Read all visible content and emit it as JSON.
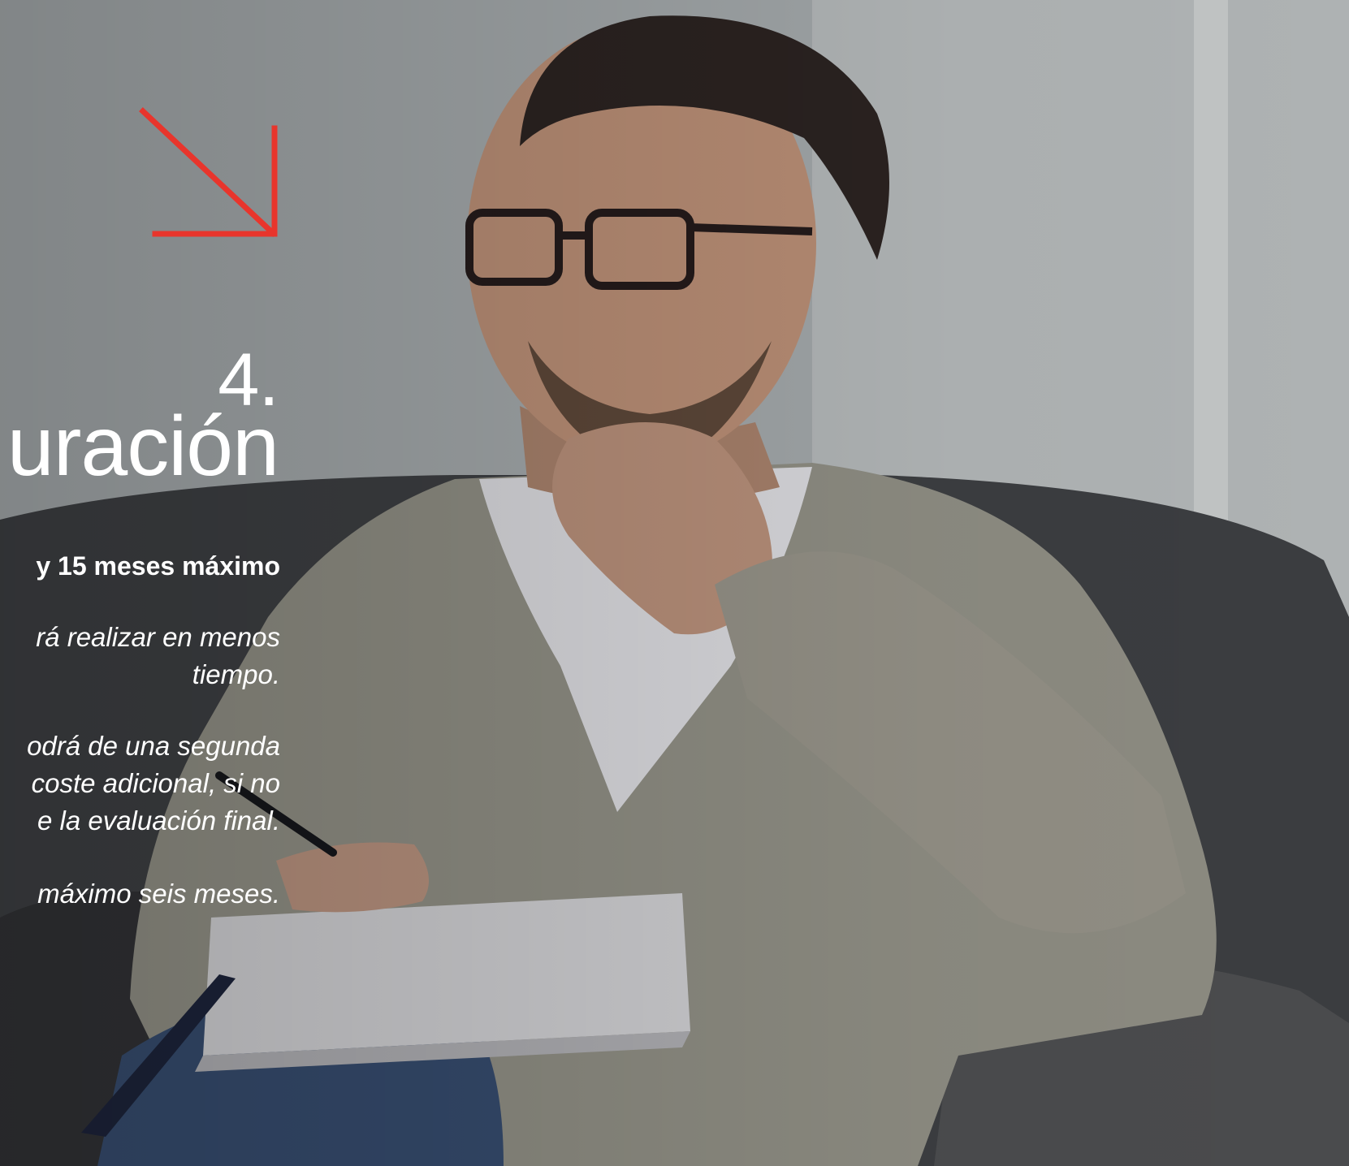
{
  "slide": {
    "number": "4.",
    "title": "uración",
    "summary": "y 15 meses máximo",
    "lines": [
      "rá realizar en menos",
      "tiempo.",
      "odrá de una segunda",
      "coste adicional, si no",
      "e la evaluación final.",
      "máximo seis meses."
    ]
  },
  "colors": {
    "accent": "#e8352c",
    "text": "#ffffff"
  },
  "icons": {
    "arrow": "arrow-down-right-icon"
  }
}
